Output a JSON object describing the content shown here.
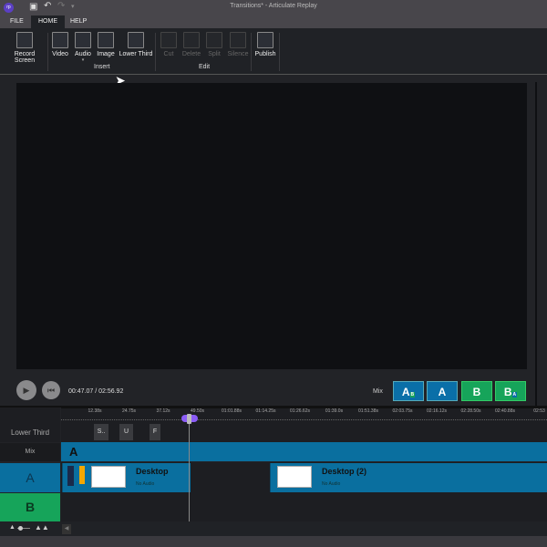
{
  "window": {
    "title": "Transitions* - Articulate Replay",
    "app_badge": "rp"
  },
  "tabs": [
    "FILE",
    "HOME",
    "HELP"
  ],
  "ribbon": {
    "record_screen": "Record Screen",
    "insert": [
      "Video",
      "Audio",
      "Image",
      "Lower Third"
    ],
    "insert_group": "Insert",
    "edit": [
      "Cut",
      "Delete",
      "Split",
      "Silence"
    ],
    "edit_group": "Edit",
    "publish": "Publish"
  },
  "player": {
    "time": "00:47.07 / 02:56.92",
    "mix_label": "Mix",
    "mix_buttons": [
      {
        "label": "A",
        "sub": "B"
      },
      {
        "label": "A"
      },
      {
        "label": "B"
      },
      {
        "label": "B",
        "sub": "A"
      }
    ]
  },
  "timeline": {
    "ticks": [
      "12.38s",
      "24.75s",
      "37.12s",
      "49.50s",
      "01:01.88s",
      "01:14.25s",
      "01:26.62s",
      "01:39.0s",
      "01:51.38s",
      "02:03.75s",
      "02:16.12s",
      "02:28.50s",
      "02:40.88s",
      "02:53"
    ],
    "tracks": {
      "lower_third": "Lower Third",
      "mix": "Mix",
      "a": "A",
      "b": "B"
    },
    "lower_third_clips": [
      "S..",
      "U",
      "F"
    ],
    "mix_clip": "A",
    "clips": [
      {
        "title": "Desktop",
        "sub": "No Audio"
      },
      {
        "title": "Desktop (2)",
        "sub": "No Audio"
      }
    ]
  },
  "colors": {
    "a": "#0a6f9f",
    "b": "#16a45a",
    "playhead": "#8b5cf6"
  }
}
